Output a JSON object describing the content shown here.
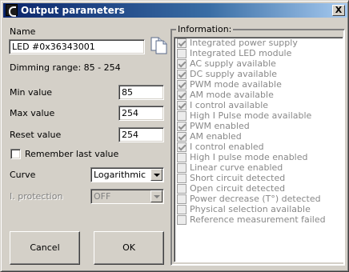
{
  "window": {
    "title": "Output parameters",
    "close_label": "X"
  },
  "left": {
    "name_label": "Name",
    "name_value": "LED #0x36343001",
    "dimming_range": "Dimming range: 85 - 254",
    "min_label": "Min value",
    "min_value": "85",
    "max_label": "Max value",
    "max_value": "254",
    "reset_label": "Reset value",
    "reset_value": "254",
    "remember_label": "Remember last value",
    "remember_checked": false,
    "curve_label": "Curve",
    "curve_value": "Logarithmic",
    "protection_label": "I. protection",
    "protection_value": "OFF",
    "cancel_label": "Cancel",
    "ok_label": "OK"
  },
  "info": {
    "legend": "Information:",
    "items": [
      {
        "label": "Integrated power supply",
        "checked": true
      },
      {
        "label": "Integrated LED module",
        "checked": false
      },
      {
        "label": "AC supply available",
        "checked": true
      },
      {
        "label": "DC supply available",
        "checked": true
      },
      {
        "label": "PWM mode available",
        "checked": true
      },
      {
        "label": "AM mode available",
        "checked": true
      },
      {
        "label": "I control available",
        "checked": true
      },
      {
        "label": "High I Pulse mode available",
        "checked": false
      },
      {
        "label": "PWM enabled",
        "checked": true
      },
      {
        "label": "AM enabled",
        "checked": true
      },
      {
        "label": "I control enabled",
        "checked": true
      },
      {
        "label": "High I pulse mode enabled",
        "checked": false
      },
      {
        "label": "Linear curve enabled",
        "checked": false
      },
      {
        "label": "Short circuit detected",
        "checked": false
      },
      {
        "label": "Open circuit detected",
        "checked": false
      },
      {
        "label": "Power decrease (T°) detected",
        "checked": false
      },
      {
        "label": "Physical selection available",
        "checked": false
      },
      {
        "label": "Reference measurement failed",
        "checked": false
      }
    ]
  }
}
